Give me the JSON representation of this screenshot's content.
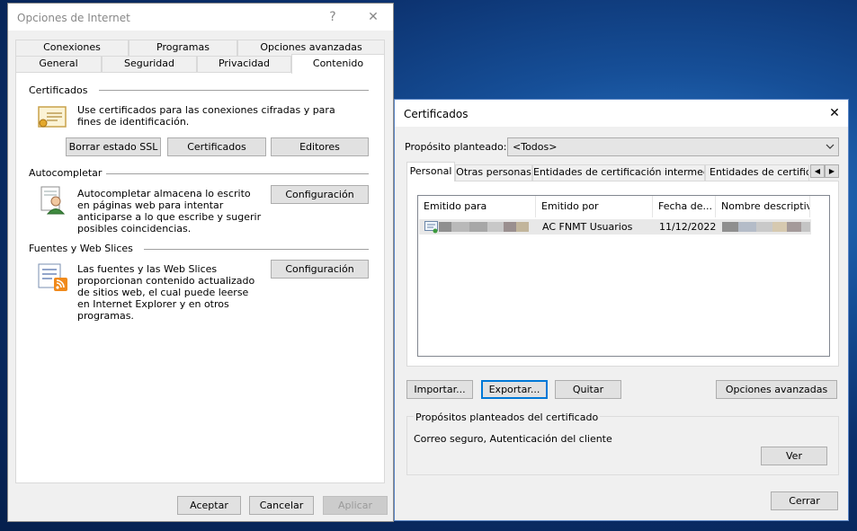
{
  "internet_options": {
    "title": "Opciones de Internet",
    "help_glyph": "?",
    "close_glyph": "✕",
    "tabs_row1": [
      "Conexiones",
      "Programas",
      "Opciones avanzadas"
    ],
    "tabs_row2": [
      "General",
      "Seguridad",
      "Privacidad",
      "Contenido"
    ],
    "certificates": {
      "title": "Certificados",
      "desc": "Use certificados para las conexiones cifradas y para fines de identificación.",
      "buttons": [
        "Borrar estado SSL",
        "Certificados",
        "Editores"
      ]
    },
    "autocomplete": {
      "title": "Autocompletar",
      "desc": "Autocompletar almacena lo escrito en páginas web para intentar anticiparse a lo que escribe y sugerir posibles coincidencias.",
      "button": "Configuración"
    },
    "feeds": {
      "title": "Fuentes y Web Slices",
      "desc": "Las fuentes y las Web Slices proporcionan contenido actualizado de sitios web, el cual puede leerse en Internet Explorer y en otros programas.",
      "button": "Configuración"
    },
    "footer": {
      "ok": "Aceptar",
      "cancel": "Cancelar",
      "apply": "Aplicar"
    }
  },
  "certificates_dialog": {
    "title": "Certificados",
    "close_glyph": "✕",
    "purpose_label": "Propósito planteado:",
    "purpose_value": "<Todos>",
    "tabs": [
      "Personal",
      "Otras personas",
      "Entidades de certificación intermedias",
      "Entidades de certificac"
    ],
    "columns": [
      "Emitido para",
      "Emitido por",
      "Fecha de...",
      "Nombre descriptivo"
    ],
    "rows": [
      {
        "issued_by": "AC FNMT Usuarios",
        "date": "11/12/2022"
      }
    ],
    "buttons": {
      "import": "Importar...",
      "export": "Exportar...",
      "remove": "Quitar",
      "advanced": "Opciones avanzadas"
    },
    "purposes_group": {
      "title": "Propósitos planteados del certificado",
      "value": "Correo seguro, Autenticación del cliente",
      "view_button": "Ver"
    },
    "close_button": "Cerrar"
  },
  "colors": {
    "accent": "#0078d7",
    "row_bg": "#e8e8e8"
  }
}
